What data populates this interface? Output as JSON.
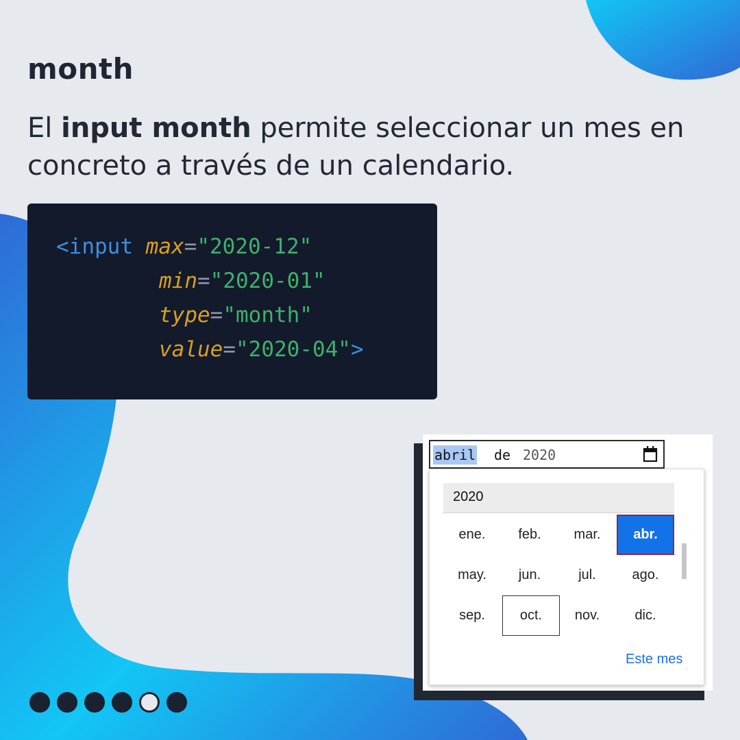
{
  "heading": "month",
  "description": {
    "part1": "El ",
    "bold": "input month",
    "part2": " permite seleccionar un mes en concreto a través de un calendario."
  },
  "code": {
    "open": "<input",
    "attrs": [
      {
        "name": "max",
        "value": "\"2020-12\""
      },
      {
        "name": "min",
        "value": "\"2020-01\""
      },
      {
        "name": "type",
        "value": "\"month\""
      },
      {
        "name": "value",
        "value": "\"2020-04\""
      }
    ],
    "eq": "=",
    "close": ">"
  },
  "widget": {
    "input": {
      "month": "abril",
      "de": "de",
      "year": "2020",
      "icon": "calendar-icon"
    },
    "popup": {
      "year": "2020",
      "months": [
        "ene.",
        "feb.",
        "mar.",
        "abr.",
        "may.",
        "jun.",
        "jul.",
        "ago.",
        "sep.",
        "oct.",
        "nov.",
        "dic."
      ],
      "selected_month": "abr.",
      "focused_month": "oct.",
      "today_button": "Este mes"
    }
  },
  "pagination": {
    "total": 6,
    "active_index": 5
  },
  "colors": {
    "background": "#e6e9ee",
    "blob_gradient_start": "#12c6f5",
    "blob_gradient_end": "#2f6bd6",
    "code_bg": "#121a2b",
    "code_tag": "#3d8fde",
    "code_attr": "#d9a01d",
    "code_string": "#3eb16b",
    "selected_month": "#1273e8",
    "link": "#1a73e8"
  }
}
